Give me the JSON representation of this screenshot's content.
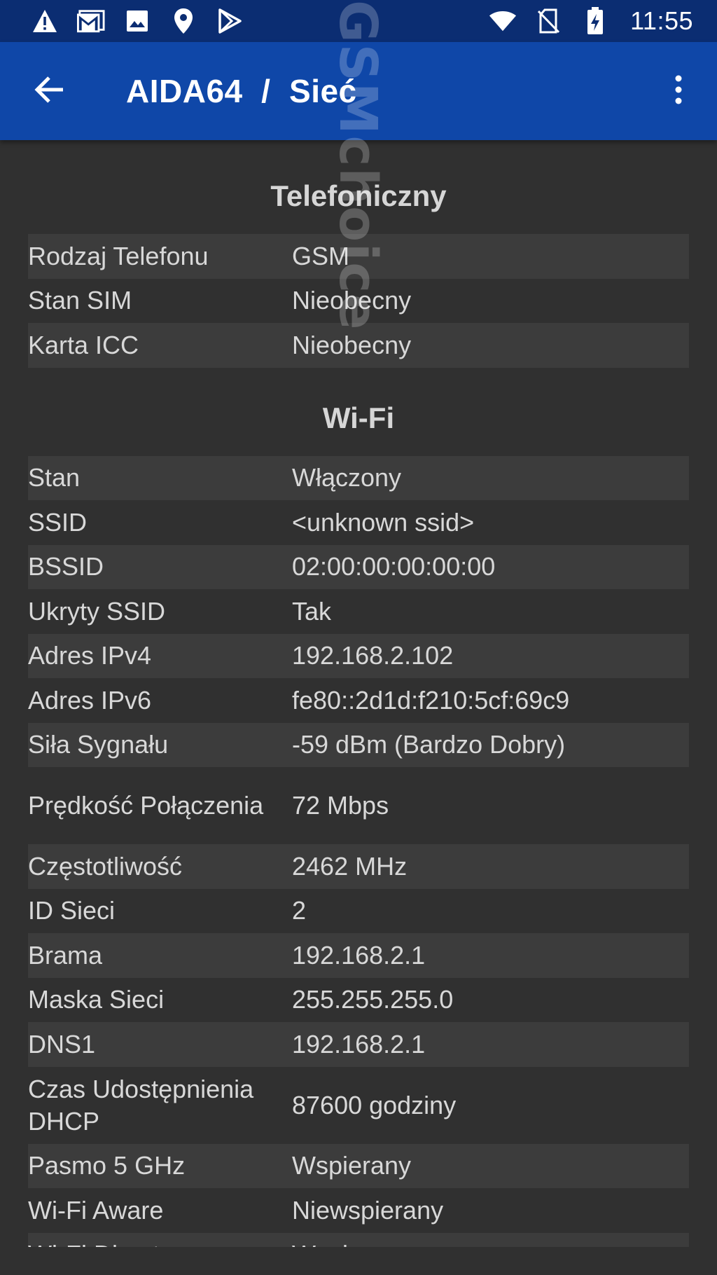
{
  "status_bar": {
    "icons_left": [
      "warning-icon",
      "gmail-icon",
      "image-icon",
      "location-icon",
      "play-store-icon"
    ],
    "icons_right": [
      "wifi-icon",
      "no-sim-icon",
      "battery-charging-icon"
    ],
    "time": "11:55"
  },
  "app_bar": {
    "title": "AIDA64  /  Sieć",
    "back_icon": "arrow-back-icon",
    "menu_icon": "more-vert-icon",
    "color": "#0f47a8"
  },
  "sections": [
    {
      "title": "Telefoniczny",
      "rows": [
        {
          "key": "Rodzaj Telefonu",
          "value": "GSM"
        },
        {
          "key": "Stan SIM",
          "value": "Nieobecny"
        },
        {
          "key": "Karta ICC",
          "value": "Nieobecny"
        }
      ]
    },
    {
      "title": "Wi-Fi",
      "rows": [
        {
          "key": "Stan",
          "value": "Włączony"
        },
        {
          "key": "SSID",
          "value": "<unknown ssid>"
        },
        {
          "key": "BSSID",
          "value": "02:00:00:00:00:00"
        },
        {
          "key": "Ukryty SSID",
          "value": "Tak"
        },
        {
          "key": "Adres IPv4",
          "value": "192.168.2.102"
        },
        {
          "key": "Adres IPv6",
          "value": "fe80::2d1d:f210:5cf:69c9"
        },
        {
          "key": "Siła Sygnału",
          "value": "-59 dBm (Bardzo Dobry)"
        },
        {
          "key": "Prędkość Połączenia",
          "value": "72 Mbps"
        },
        {
          "key": "Częstotliwość",
          "value": "2462 MHz"
        },
        {
          "key": "ID Sieci",
          "value": "2"
        },
        {
          "key": "Brama",
          "value": "192.168.2.1"
        },
        {
          "key": "Maska Sieci",
          "value": "255.255.255.0"
        },
        {
          "key": "DNS1",
          "value": "192.168.2.1"
        },
        {
          "key": "Czas Udostępnienia DHCP",
          "value": "87600 godziny"
        },
        {
          "key": "Pasmo 5 GHz",
          "value": "Wspierany"
        },
        {
          "key": "Wi-Fi Aware",
          "value": "Niewspierany"
        },
        {
          "key": "Wi-Fi Direct",
          "value": "Wspierany"
        }
      ]
    }
  ],
  "watermark": "GSMchoice"
}
